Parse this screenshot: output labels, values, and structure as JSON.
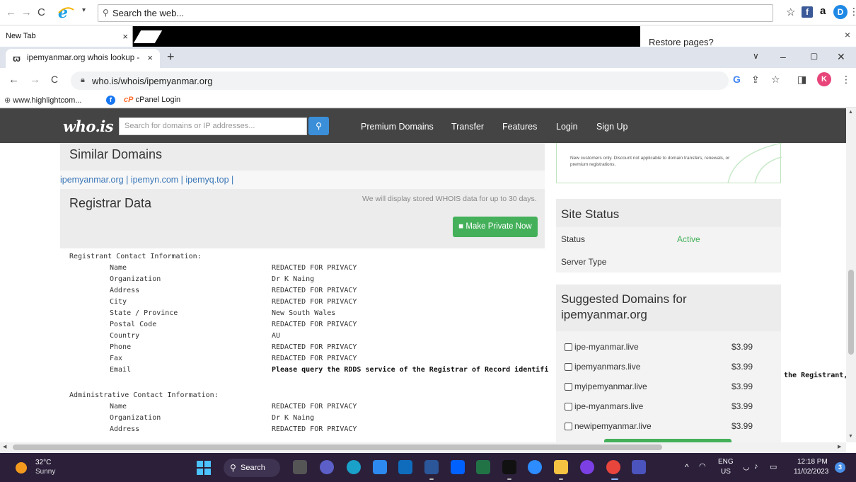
{
  "outer_browser": {
    "search_placeholder": "Search the web..."
  },
  "legacy_tabs": {
    "new_tab_label": "New Tab",
    "close_glyph": "×",
    "restore_prompt": "Restore pages?"
  },
  "chrome": {
    "tab_title": "ipemyanmar.org whois lookup - ",
    "tab_close": "×",
    "new_tab": "+",
    "url": "who.is/whois/ipemyanmar.org",
    "profile_initial": "K",
    "bookmarks": [
      "www.highlightcom...",
      "cPanel Login"
    ]
  },
  "whois": {
    "logo": "who.is",
    "search_placeholder": "Search for domains or IP addresses...",
    "nav": [
      "Premium Domains",
      "Transfer",
      "Features",
      "Login",
      "Sign Up"
    ],
    "similar_heading": "Similar Domains",
    "similar_links": "ipemyanmar.org | ipemyn.com | ipemyq.top |",
    "registrar_heading": "Registrar Data",
    "stored_note": "We will display stored WHOIS data for up to 30 days.",
    "make_private": "Make Private Now",
    "registrant_heading": "Registrant Contact Information:",
    "registrant": [
      {
        "k": "Name",
        "v": "REDACTED FOR PRIVACY"
      },
      {
        "k": "Organization",
        "v": "Dr K Naing"
      },
      {
        "k": "Address",
        "v": "REDACTED FOR PRIVACY"
      },
      {
        "k": "City",
        "v": "REDACTED FOR PRIVACY"
      },
      {
        "k": "State / Province",
        "v": "New South Wales"
      },
      {
        "k": "Postal Code",
        "v": "REDACTED FOR PRIVACY"
      },
      {
        "k": "Country",
        "v": "AU"
      },
      {
        "k": "Phone",
        "v": "REDACTED FOR PRIVACY"
      },
      {
        "k": "Fax",
        "v": "REDACTED FOR PRIVACY"
      },
      {
        "k": "Email",
        "v": "Please query the RDDS service of the Registrar of Record identifi"
      }
    ],
    "email_overflow": "the Registrant,",
    "admin_heading": "Administrative Contact Information:",
    "admin": [
      {
        "k": "Name",
        "v": "REDACTED FOR PRIVACY"
      },
      {
        "k": "Organization",
        "v": "Dr K Naing"
      },
      {
        "k": "Address",
        "v": "REDACTED FOR PRIVACY"
      }
    ],
    "promo_text": "New customers only. Discount not applicable to domain transfers, renewals, or premium registrations.",
    "site_status_heading": "Site Status",
    "status_label": "Status",
    "status_value": "Active",
    "server_type_label": "Server Type",
    "suggested_heading": "Suggested Domains for ipemyanmar.org",
    "suggested": [
      {
        "name": "ipe-myanmar.live",
        "price": "$3.99"
      },
      {
        "name": "ipemyanmars.live",
        "price": "$3.99"
      },
      {
        "name": "myipemyanmar.live",
        "price": "$3.99"
      },
      {
        "name": "ipe-myanmars.live",
        "price": "$3.99"
      },
      {
        "name": "newipemyanmar.live",
        "price": "$3.99"
      }
    ]
  },
  "taskbar": {
    "temp": "32°C",
    "weather": "Sunny",
    "search_label": "Search",
    "lang_top": "ENG",
    "lang_bottom": "US",
    "time": "12:18 PM",
    "date": "11/02/2023",
    "notif_count": "3"
  },
  "colors": {
    "whois_nav": "#444444",
    "accent_green": "#44b05a",
    "link_blue": "#3a77b8",
    "status_active": "#44b05a",
    "taskbar": "#2b1f3a"
  }
}
